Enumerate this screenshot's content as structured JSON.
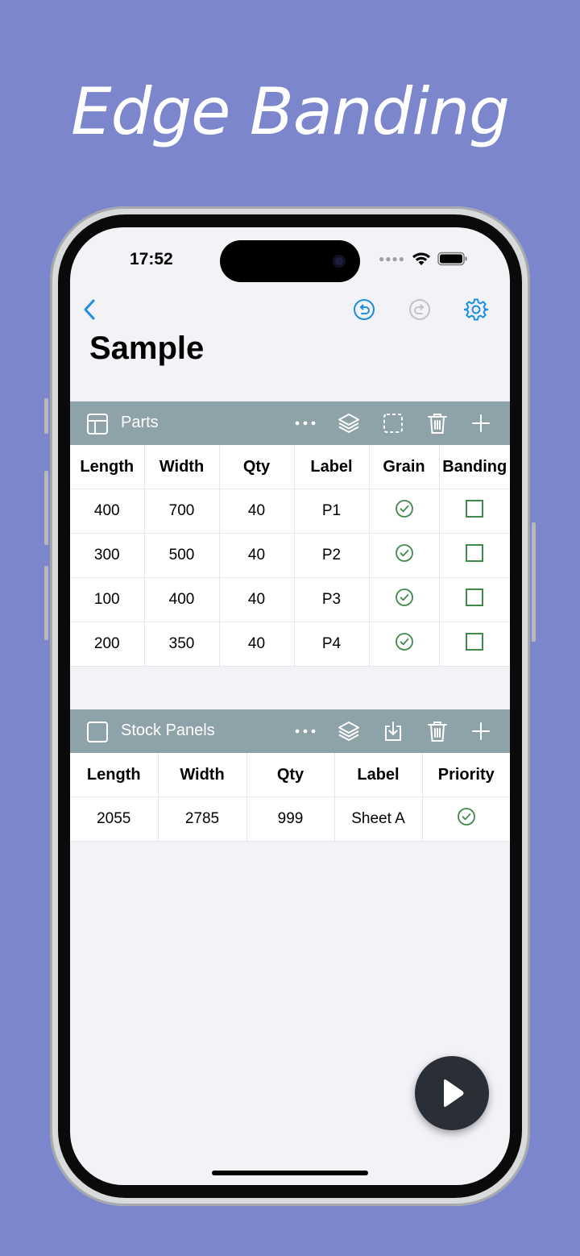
{
  "headline": "Edge Banding",
  "status_bar": {
    "time": "17:52"
  },
  "page_title": "Sample",
  "colors": {
    "background": "#7b86cc",
    "accent": "#1a8fe3",
    "section_header": "#8ea2aa",
    "check_green": "#3f8a4b",
    "fab": "#2a2f37"
  },
  "parts": {
    "title": "Parts",
    "columns": [
      "Length",
      "Width",
      "Qty",
      "Label",
      "Grain",
      "Banding"
    ],
    "rows": [
      {
        "length": "400",
        "width": "700",
        "qty": "40",
        "label": "P1",
        "grain": true,
        "banding": false
      },
      {
        "length": "300",
        "width": "500",
        "qty": "40",
        "label": "P2",
        "grain": true,
        "banding": false
      },
      {
        "length": "100",
        "width": "400",
        "qty": "40",
        "label": "P3",
        "grain": true,
        "banding": false
      },
      {
        "length": "200",
        "width": "350",
        "qty": "40",
        "label": "P4",
        "grain": true,
        "banding": false
      }
    ]
  },
  "stock": {
    "title": "Stock Panels",
    "columns": [
      "Length",
      "Width",
      "Qty",
      "Label",
      "Priority"
    ],
    "rows": [
      {
        "length": "2055",
        "width": "2785",
        "qty": "999",
        "label": "Sheet A",
        "priority": true
      }
    ]
  }
}
